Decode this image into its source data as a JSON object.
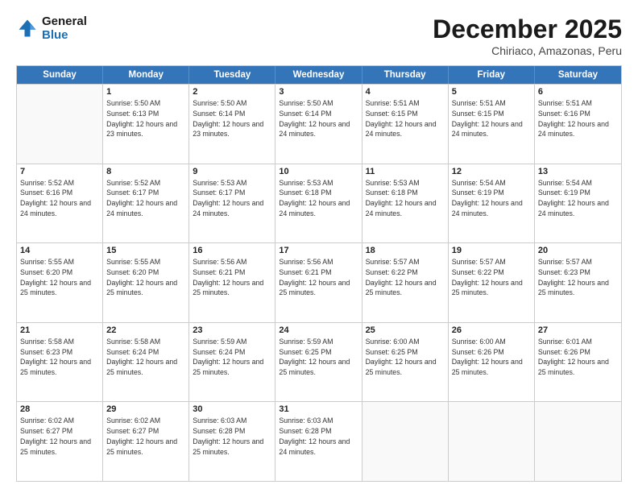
{
  "logo": {
    "line1": "General",
    "line2": "Blue"
  },
  "title": "December 2025",
  "subtitle": "Chiriaco, Amazonas, Peru",
  "days": [
    "Sunday",
    "Monday",
    "Tuesday",
    "Wednesday",
    "Thursday",
    "Friday",
    "Saturday"
  ],
  "rows": [
    [
      {
        "day": "",
        "sunrise": "",
        "sunset": "",
        "daylight": ""
      },
      {
        "day": "1",
        "sunrise": "Sunrise: 5:50 AM",
        "sunset": "Sunset: 6:13 PM",
        "daylight": "Daylight: 12 hours and 23 minutes."
      },
      {
        "day": "2",
        "sunrise": "Sunrise: 5:50 AM",
        "sunset": "Sunset: 6:14 PM",
        "daylight": "Daylight: 12 hours and 23 minutes."
      },
      {
        "day": "3",
        "sunrise": "Sunrise: 5:50 AM",
        "sunset": "Sunset: 6:14 PM",
        "daylight": "Daylight: 12 hours and 24 minutes."
      },
      {
        "day": "4",
        "sunrise": "Sunrise: 5:51 AM",
        "sunset": "Sunset: 6:15 PM",
        "daylight": "Daylight: 12 hours and 24 minutes."
      },
      {
        "day": "5",
        "sunrise": "Sunrise: 5:51 AM",
        "sunset": "Sunset: 6:15 PM",
        "daylight": "Daylight: 12 hours and 24 minutes."
      },
      {
        "day": "6",
        "sunrise": "Sunrise: 5:51 AM",
        "sunset": "Sunset: 6:16 PM",
        "daylight": "Daylight: 12 hours and 24 minutes."
      }
    ],
    [
      {
        "day": "7",
        "sunrise": "Sunrise: 5:52 AM",
        "sunset": "Sunset: 6:16 PM",
        "daylight": "Daylight: 12 hours and 24 minutes."
      },
      {
        "day": "8",
        "sunrise": "Sunrise: 5:52 AM",
        "sunset": "Sunset: 6:17 PM",
        "daylight": "Daylight: 12 hours and 24 minutes."
      },
      {
        "day": "9",
        "sunrise": "Sunrise: 5:53 AM",
        "sunset": "Sunset: 6:17 PM",
        "daylight": "Daylight: 12 hours and 24 minutes."
      },
      {
        "day": "10",
        "sunrise": "Sunrise: 5:53 AM",
        "sunset": "Sunset: 6:18 PM",
        "daylight": "Daylight: 12 hours and 24 minutes."
      },
      {
        "day": "11",
        "sunrise": "Sunrise: 5:53 AM",
        "sunset": "Sunset: 6:18 PM",
        "daylight": "Daylight: 12 hours and 24 minutes."
      },
      {
        "day": "12",
        "sunrise": "Sunrise: 5:54 AM",
        "sunset": "Sunset: 6:19 PM",
        "daylight": "Daylight: 12 hours and 24 minutes."
      },
      {
        "day": "13",
        "sunrise": "Sunrise: 5:54 AM",
        "sunset": "Sunset: 6:19 PM",
        "daylight": "Daylight: 12 hours and 24 minutes."
      }
    ],
    [
      {
        "day": "14",
        "sunrise": "Sunrise: 5:55 AM",
        "sunset": "Sunset: 6:20 PM",
        "daylight": "Daylight: 12 hours and 25 minutes."
      },
      {
        "day": "15",
        "sunrise": "Sunrise: 5:55 AM",
        "sunset": "Sunset: 6:20 PM",
        "daylight": "Daylight: 12 hours and 25 minutes."
      },
      {
        "day": "16",
        "sunrise": "Sunrise: 5:56 AM",
        "sunset": "Sunset: 6:21 PM",
        "daylight": "Daylight: 12 hours and 25 minutes."
      },
      {
        "day": "17",
        "sunrise": "Sunrise: 5:56 AM",
        "sunset": "Sunset: 6:21 PM",
        "daylight": "Daylight: 12 hours and 25 minutes."
      },
      {
        "day": "18",
        "sunrise": "Sunrise: 5:57 AM",
        "sunset": "Sunset: 6:22 PM",
        "daylight": "Daylight: 12 hours and 25 minutes."
      },
      {
        "day": "19",
        "sunrise": "Sunrise: 5:57 AM",
        "sunset": "Sunset: 6:22 PM",
        "daylight": "Daylight: 12 hours and 25 minutes."
      },
      {
        "day": "20",
        "sunrise": "Sunrise: 5:57 AM",
        "sunset": "Sunset: 6:23 PM",
        "daylight": "Daylight: 12 hours and 25 minutes."
      }
    ],
    [
      {
        "day": "21",
        "sunrise": "Sunrise: 5:58 AM",
        "sunset": "Sunset: 6:23 PM",
        "daylight": "Daylight: 12 hours and 25 minutes."
      },
      {
        "day": "22",
        "sunrise": "Sunrise: 5:58 AM",
        "sunset": "Sunset: 6:24 PM",
        "daylight": "Daylight: 12 hours and 25 minutes."
      },
      {
        "day": "23",
        "sunrise": "Sunrise: 5:59 AM",
        "sunset": "Sunset: 6:24 PM",
        "daylight": "Daylight: 12 hours and 25 minutes."
      },
      {
        "day": "24",
        "sunrise": "Sunrise: 5:59 AM",
        "sunset": "Sunset: 6:25 PM",
        "daylight": "Daylight: 12 hours and 25 minutes."
      },
      {
        "day": "25",
        "sunrise": "Sunrise: 6:00 AM",
        "sunset": "Sunset: 6:25 PM",
        "daylight": "Daylight: 12 hours and 25 minutes."
      },
      {
        "day": "26",
        "sunrise": "Sunrise: 6:00 AM",
        "sunset": "Sunset: 6:26 PM",
        "daylight": "Daylight: 12 hours and 25 minutes."
      },
      {
        "day": "27",
        "sunrise": "Sunrise: 6:01 AM",
        "sunset": "Sunset: 6:26 PM",
        "daylight": "Daylight: 12 hours and 25 minutes."
      }
    ],
    [
      {
        "day": "28",
        "sunrise": "Sunrise: 6:02 AM",
        "sunset": "Sunset: 6:27 PM",
        "daylight": "Daylight: 12 hours and 25 minutes."
      },
      {
        "day": "29",
        "sunrise": "Sunrise: 6:02 AM",
        "sunset": "Sunset: 6:27 PM",
        "daylight": "Daylight: 12 hours and 25 minutes."
      },
      {
        "day": "30",
        "sunrise": "Sunrise: 6:03 AM",
        "sunset": "Sunset: 6:28 PM",
        "daylight": "Daylight: 12 hours and 25 minutes."
      },
      {
        "day": "31",
        "sunrise": "Sunrise: 6:03 AM",
        "sunset": "Sunset: 6:28 PM",
        "daylight": "Daylight: 12 hours and 24 minutes."
      },
      {
        "day": "",
        "sunrise": "",
        "sunset": "",
        "daylight": ""
      },
      {
        "day": "",
        "sunrise": "",
        "sunset": "",
        "daylight": ""
      },
      {
        "day": "",
        "sunrise": "",
        "sunset": "",
        "daylight": ""
      }
    ]
  ]
}
